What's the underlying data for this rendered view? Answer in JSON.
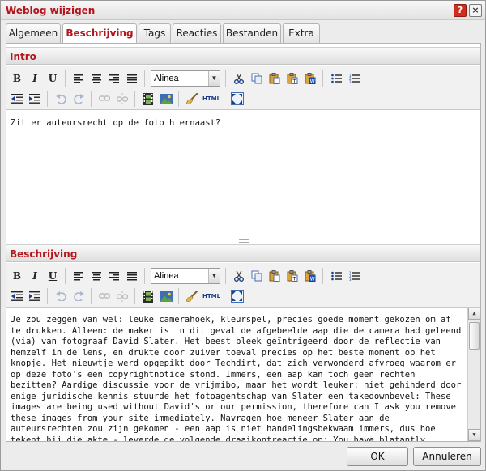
{
  "window": {
    "title": "Weblog wijzigen",
    "help_label": "?",
    "close_label": "×"
  },
  "tabs": [
    {
      "label": "Algemeen",
      "active": false
    },
    {
      "label": "Beschrijving",
      "active": true
    },
    {
      "label": "Tags",
      "active": false
    },
    {
      "label": "Reacties",
      "active": false
    },
    {
      "label": "Bestanden",
      "active": false
    },
    {
      "label": "Extra",
      "active": false
    }
  ],
  "toolbar": {
    "bold": "B",
    "italic": "I",
    "underline": "U",
    "format_select": "Alinea",
    "html_label": "HTML",
    "icons": [
      "bold-icon",
      "italic-icon",
      "underline-icon",
      "align-left-icon",
      "align-center-icon",
      "align-right-icon",
      "align-justify-icon",
      "cut-icon",
      "copy-icon",
      "paste-icon",
      "paste-text-icon",
      "paste-word-icon",
      "bullet-list-icon",
      "numbered-list-icon",
      "outdent-icon",
      "indent-icon",
      "undo-icon",
      "redo-icon",
      "link-icon",
      "unlink-icon",
      "media-icon",
      "image-icon",
      "cleanup-icon",
      "html-source-icon",
      "fullscreen-icon"
    ]
  },
  "intro": {
    "heading": "Intro",
    "content": "Zit er auteursrecht op de foto hiernaast?"
  },
  "description": {
    "heading": "Beschrijving",
    "content": "Je zou zeggen van wel: leuke camerahoek, kleurspel, precies goede moment gekozen om af te drukken. Alleen: de maker is in dit geval de afgebeelde aap die de camera had geleend (via) van fotograaf David Slater. Het beest bleek geïntrigeerd door de reflectie van hemzelf in de lens, en drukte door zuiver toeval precies op het beste moment op het knopje. Het nieuwtje werd opgepikt door Techdirt, dat zich verwonderd afvroeg waarom er op deze foto's een copyrightnotice stond. Immers, een aap kan toch geen rechten bezitten? Aardige discussie voor de vrijmibo, maar het wordt leuker: niet gehinderd door enige juridische kennis stuurde het fotoagentschap van Slater een takedownbevel: These images are being used without David's or our permission, therefore can I ask you remove these images from your site immediately. Navragen hoe meneer Slater aan de auteursrechten zou zijn gekomen - een aap is niet handelingsbekwaam immers, dus hoe tekent hij die akte - leverde de volgende draaikontreactie op: You have blatantly 'lifted' these"
  },
  "footer": {
    "ok": "OK",
    "cancel": "Annuleren"
  },
  "colors": {
    "accent": "#b5141c",
    "panel_bg": "#ececec"
  }
}
